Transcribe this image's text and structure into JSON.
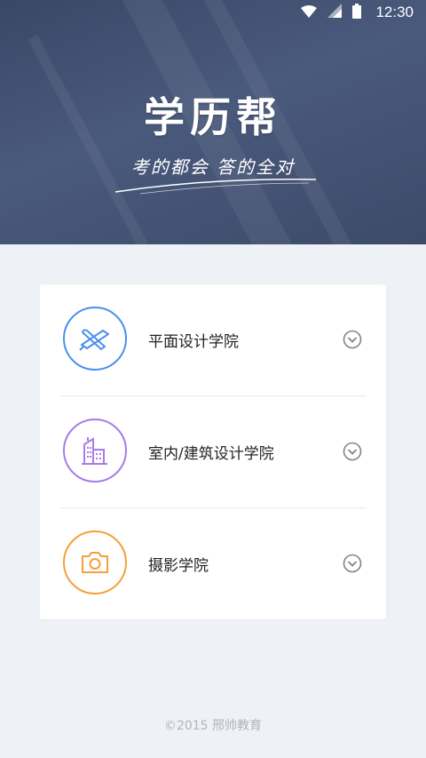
{
  "status_bar": {
    "time": "12:30"
  },
  "hero": {
    "title": "学历帮",
    "slogan": "考的都会 答的全对",
    "colors": {
      "bg": "#3a4767",
      "text": "#ffffff"
    }
  },
  "colleges": [
    {
      "label": "平面设计学院",
      "icon": "brush-pencil-icon",
      "color": "#4a90f0"
    },
    {
      "label": "室内/建筑设计学院",
      "icon": "building-icon",
      "color": "#a67ce8"
    },
    {
      "label": "摄影学院",
      "icon": "camera-icon",
      "color": "#f5a03a"
    }
  ],
  "footer": {
    "text": "©2015 邢帅教育"
  }
}
